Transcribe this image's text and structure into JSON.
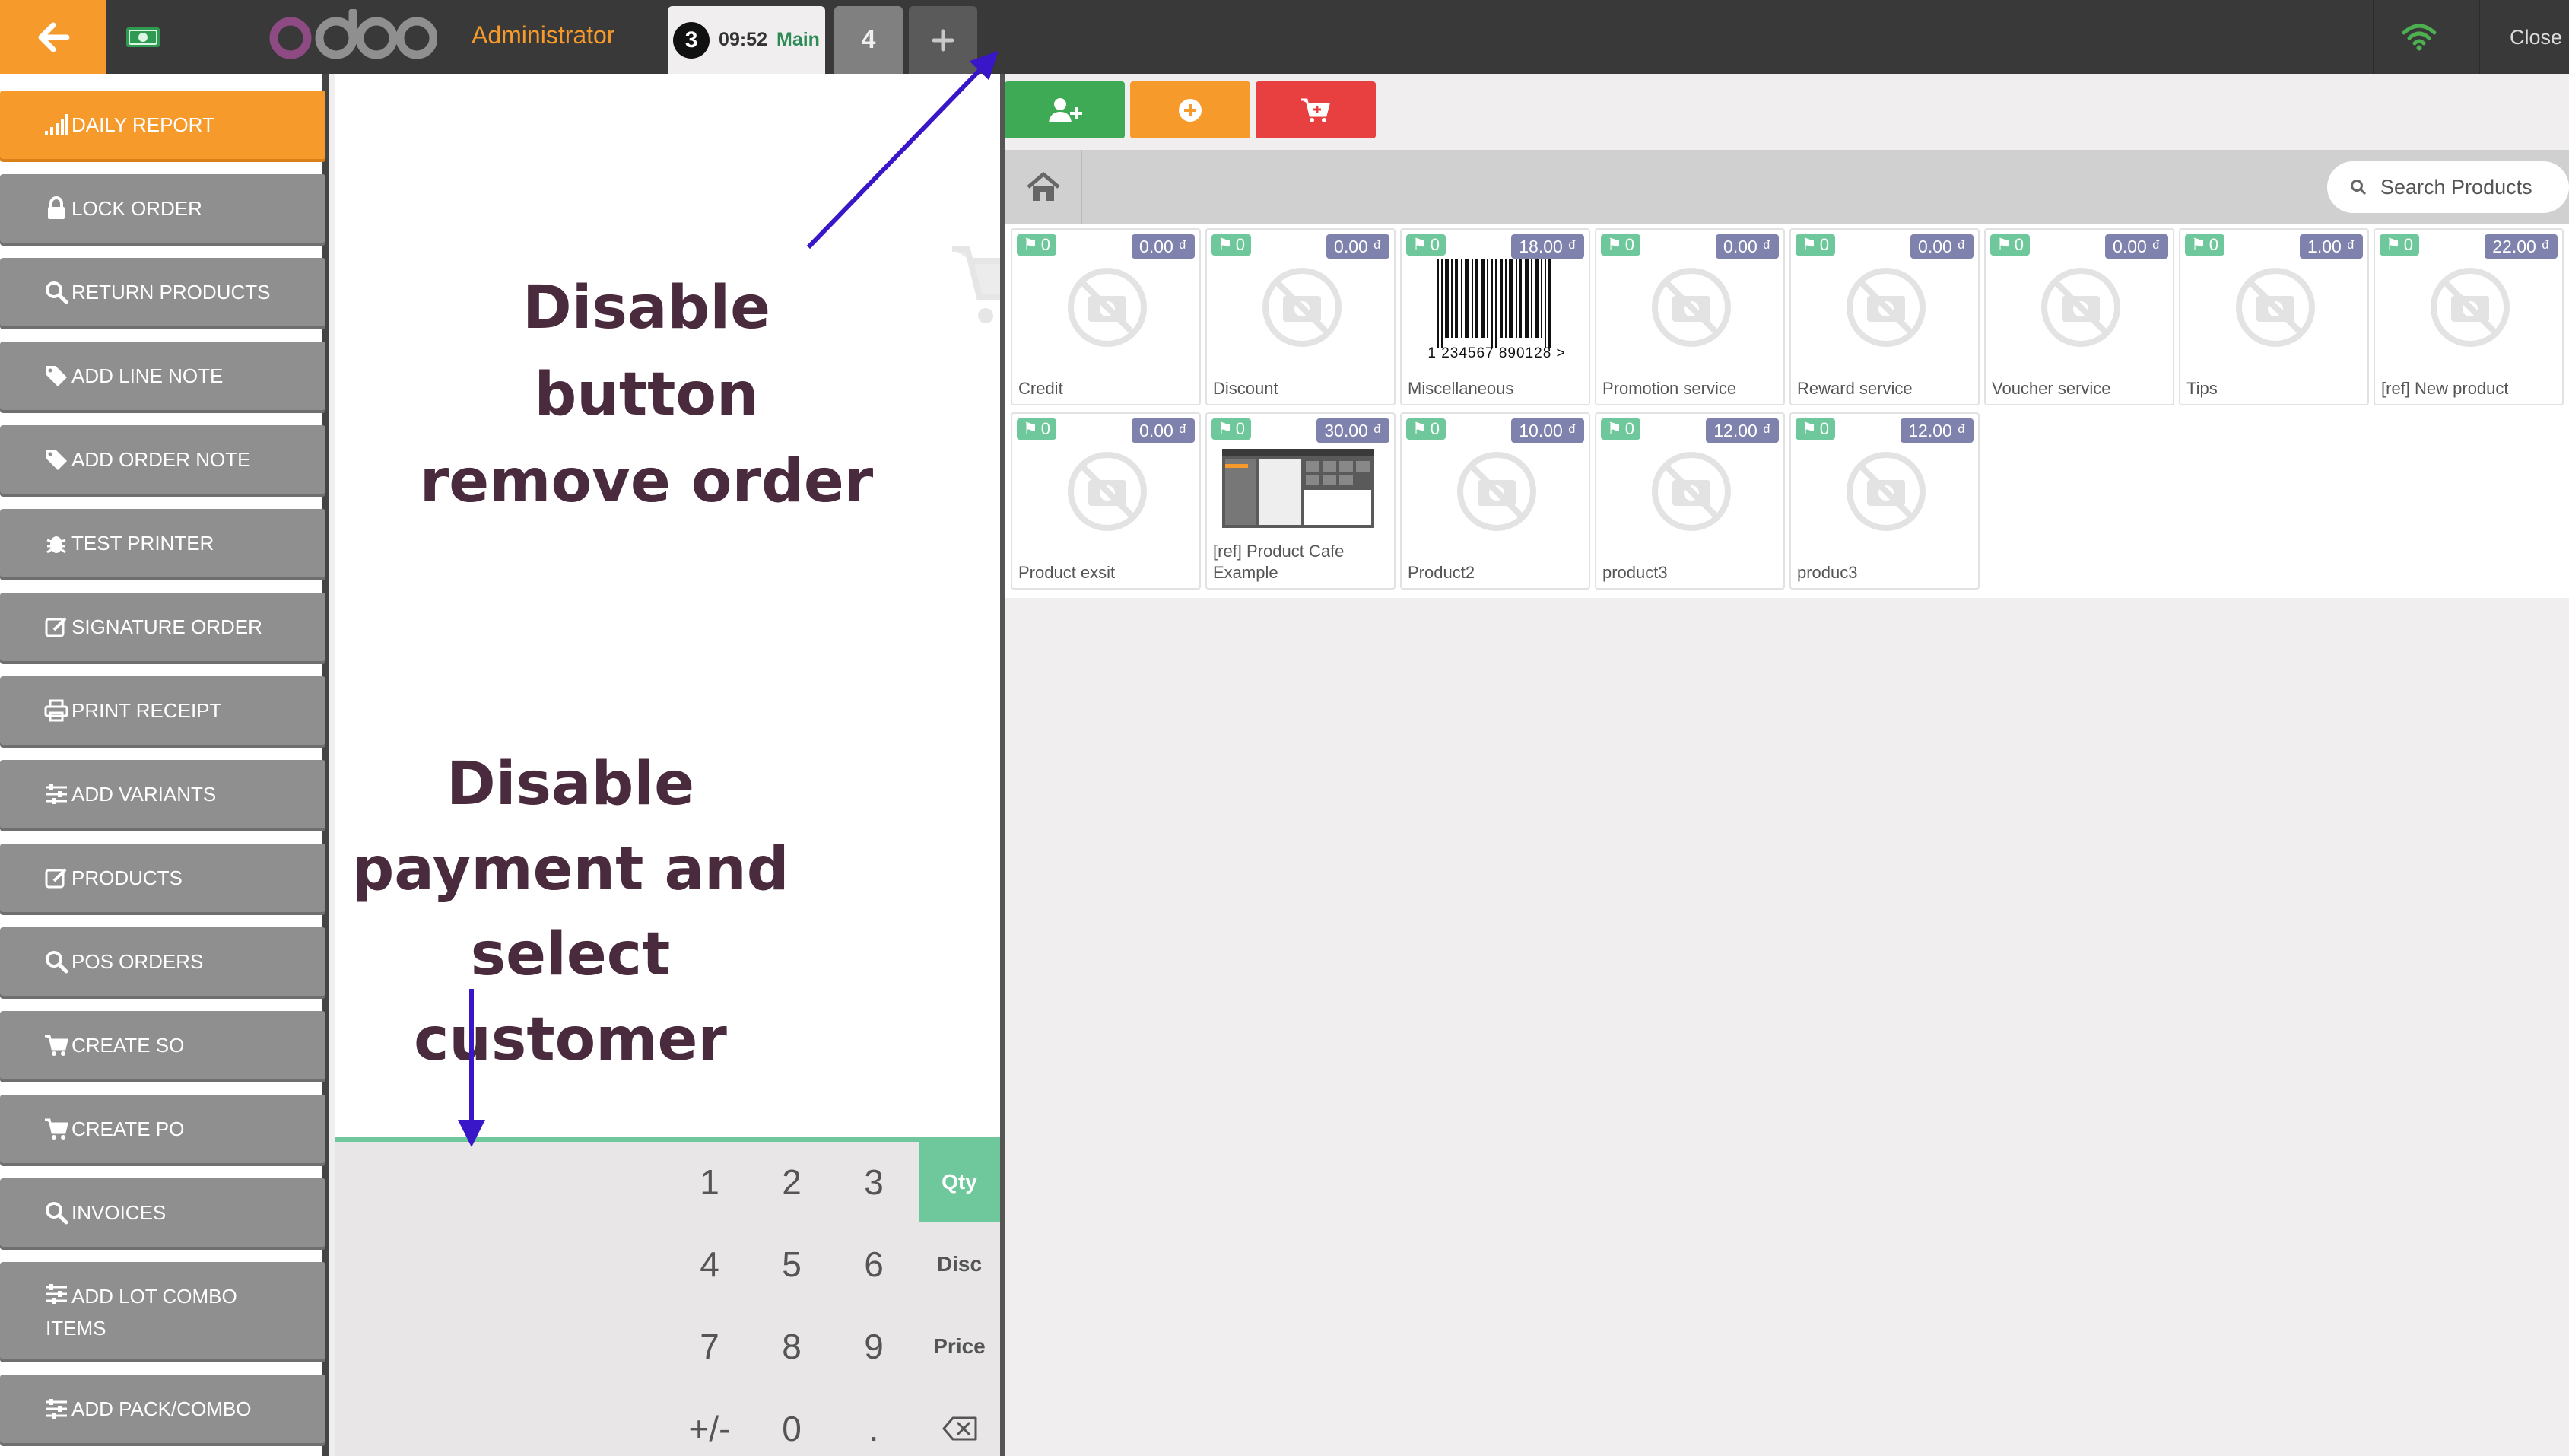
{
  "topbar": {
    "cashier": "Administrator",
    "orders": [
      {
        "seq": "3",
        "time": "09:52",
        "branch": "Main"
      },
      {
        "label": "4"
      }
    ],
    "close_label": "Close"
  },
  "sidebar": {
    "items": [
      {
        "label": "DAILY REPORT",
        "icon": "bar-chart-icon"
      },
      {
        "label": "LOCK ORDER",
        "icon": "lock-icon"
      },
      {
        "label": "RETURN PRODUCTS",
        "icon": "search-icon"
      },
      {
        "label": "ADD LINE NOTE",
        "icon": "tag-icon"
      },
      {
        "label": "ADD ORDER NOTE",
        "icon": "tag-icon"
      },
      {
        "label": "TEST PRINTER",
        "icon": "bug-icon"
      },
      {
        "label": "SIGNATURE ORDER",
        "icon": "edit-icon"
      },
      {
        "label": "PRINT RECEIPT",
        "icon": "print-icon"
      },
      {
        "label": "ADD VARIANTS",
        "icon": "sliders-icon"
      },
      {
        "label": "PRODUCTS",
        "icon": "edit-icon"
      },
      {
        "label": "POS ORDERS",
        "icon": "search-icon"
      },
      {
        "label": "CREATE SO",
        "icon": "cart-icon"
      },
      {
        "label": "CREATE PO",
        "icon": "cart-icon"
      },
      {
        "label": "INVOICES",
        "icon": "search-icon"
      },
      {
        "label": "ADD LOT COMBO ITEMS",
        "icon": "sliders-icon"
      },
      {
        "label": "ADD PACK/COMBO",
        "icon": "sliders-icon"
      }
    ]
  },
  "numpad": {
    "keys": [
      "1",
      "2",
      "3",
      "4",
      "5",
      "6",
      "7",
      "8",
      "9",
      "+/-",
      "0",
      "."
    ],
    "modes": [
      "Qty",
      "Disc",
      "Price"
    ],
    "active_mode": "Qty"
  },
  "search": {
    "placeholder": "Search Products"
  },
  "products": [
    {
      "name": "Credit",
      "price": "0.00 ₫",
      "tag": "0"
    },
    {
      "name": "Discount",
      "price": "0.00 ₫",
      "tag": "0"
    },
    {
      "name": "Miscellaneous",
      "price": "18.00 ₫",
      "tag": "0",
      "barcode": "1 234567 890128 >"
    },
    {
      "name": "Promotion service",
      "price": "0.00 ₫",
      "tag": "0"
    },
    {
      "name": "Reward service",
      "price": "0.00 ₫",
      "tag": "0"
    },
    {
      "name": "Voucher service",
      "price": "0.00 ₫",
      "tag": "0"
    },
    {
      "name": "Tips",
      "price": "1.00 ₫",
      "tag": "0"
    },
    {
      "name": "[ref] New product",
      "price": "22.00 ₫",
      "tag": "0"
    },
    {
      "name": "Product exsit",
      "price": "0.00 ₫",
      "tag": "0"
    },
    {
      "name": "[ref] Product Cafe Example",
      "price": "30.00 ₫",
      "tag": "0"
    },
    {
      "name": "Product2",
      "price": "10.00 ₫",
      "tag": "0"
    },
    {
      "name": "product3",
      "price": "12.00 ₫",
      "tag": "0"
    },
    {
      "name": "produc3",
      "price": "12.00 ₫",
      "tag": "0"
    }
  ],
  "annotations": {
    "remove_order": [
      "Disable button",
      "remove order"
    ],
    "payment": [
      "Disable",
      "payment and",
      "select customer"
    ]
  },
  "colors": {
    "topbar": "#393939",
    "accent_orange": "#f79a2c",
    "green": "#6ec89b",
    "red": "#e84040",
    "button_gray": "#8f8f8f",
    "price_badge": "#7f82ac",
    "annotation_text": "#4a2b3e",
    "annotation_arrow": "#3a16c9"
  }
}
